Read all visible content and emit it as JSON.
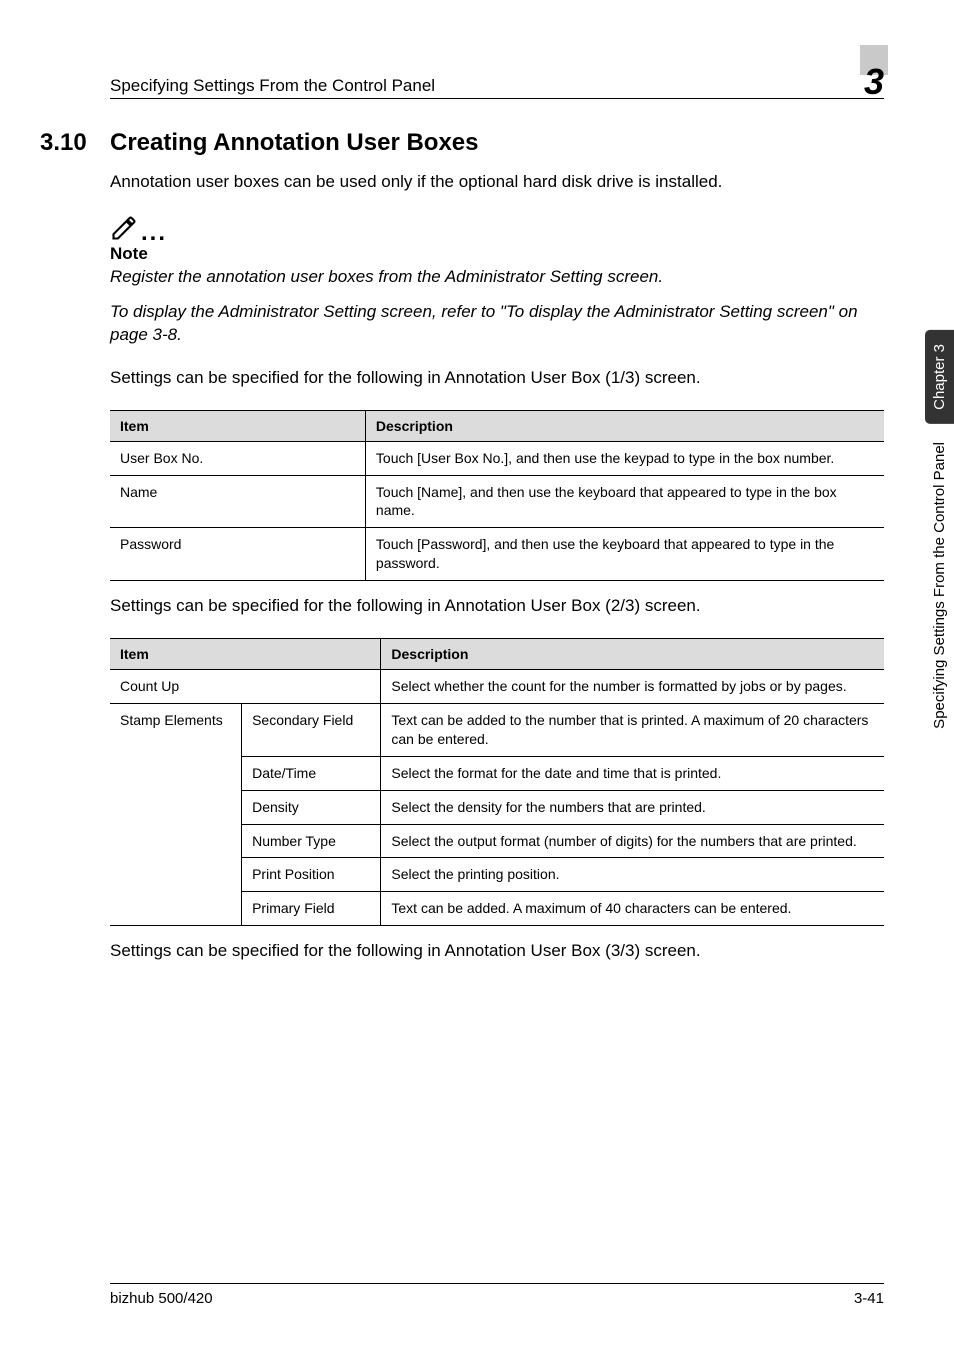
{
  "header": {
    "running_title": "Specifying Settings From the Control Panel",
    "chapter_number": "3"
  },
  "section": {
    "number": "3.10",
    "title": "Creating Annotation User Boxes"
  },
  "intro_para": "Annotation user boxes can be used only if the optional hard disk drive is installed.",
  "note": {
    "label": "Note",
    "para1": "Register the annotation user boxes from the Administrator Setting screen.",
    "para2": "To display the Administrator Setting screen, refer to \"To display the Administrator Setting screen\" on page 3-8."
  },
  "settings_intro_1": "Settings can be specified for the following in Annotation User Box (1/3) screen.",
  "table1": {
    "head_item": "Item",
    "head_desc": "Description",
    "rows": [
      {
        "item": "User Box No.",
        "desc": "Touch [User Box No.], and then use the keypad to type in the box number."
      },
      {
        "item": "Name",
        "desc": "Touch [Name], and then use the keyboard that appeared to type in the box name."
      },
      {
        "item": "Password",
        "desc": "Touch [Password], and then use the keyboard that appeared to type in the password."
      }
    ]
  },
  "settings_intro_2": "Settings can be specified for the following in Annotation User Box (2/3) screen.",
  "table2": {
    "head_item": "Item",
    "head_desc": "Description",
    "count_up_item": "Count Up",
    "count_up_desc": "Select whether the count for the number is formatted by jobs or by pages.",
    "stamp_item": "Stamp Elements",
    "rows": [
      {
        "sub": "Secondary Field",
        "desc": "Text can be added to the number that is printed. A maximum of 20 characters can be entered."
      },
      {
        "sub": "Date/Time",
        "desc": "Select the format for the date and time that is printed."
      },
      {
        "sub": "Density",
        "desc": "Select the density for the numbers that are printed."
      },
      {
        "sub": "Number Type",
        "desc": "Select the output format (number of digits) for the numbers that are printed."
      },
      {
        "sub": "Print Position",
        "desc": "Select the printing position."
      },
      {
        "sub": "Primary Field",
        "desc": "Text can be added. A maximum of 40 characters can be entered."
      }
    ]
  },
  "settings_intro_3": "Settings can be specified for the following in Annotation User Box (3/3) screen.",
  "sidebar": {
    "tab": "Chapter 3",
    "text": "Specifying Settings From the Control Panel"
  },
  "footer": {
    "left": "bizhub 500/420",
    "right": "3-41"
  }
}
